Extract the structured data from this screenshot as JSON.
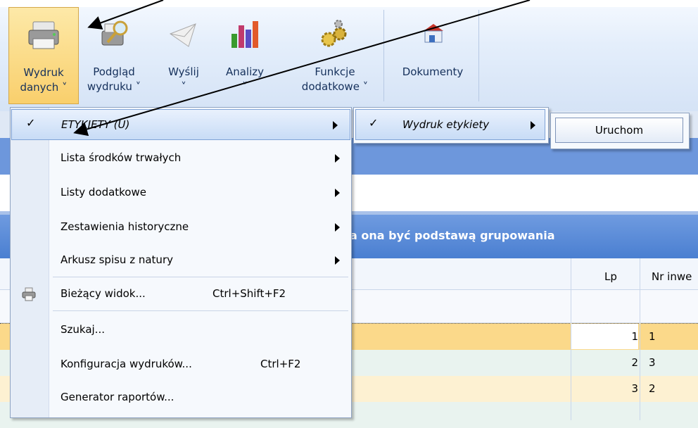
{
  "ribbon": {
    "buttons": [
      {
        "label1": "Wydruk",
        "label2": "danych ˅",
        "icon": "printer-icon"
      },
      {
        "label1": "Podgląd",
        "label2": "wydruku ˅",
        "icon": "print-preview-icon"
      },
      {
        "label1": "Wyślij",
        "label2": "˅",
        "icon": "send-mail-icon"
      },
      {
        "label1": "Analizy",
        "label2": "˅",
        "icon": "analysis-chart-icon"
      },
      {
        "label1": "Funkcje",
        "label2": "dodatkowe ˅",
        "icon": "gears-icon"
      },
      {
        "label1": "Dokumenty",
        "label2": "",
        "icon": "documents-icon"
      }
    ]
  },
  "background": {
    "header_text": "a ona być podstawą grupowania",
    "col_lp": "Lp",
    "col_nr": "Nr inwe",
    "rows": [
      {
        "lp": "1",
        "nr": "1"
      },
      {
        "lp": "2",
        "nr": "3"
      },
      {
        "lp": "3",
        "nr": "2"
      }
    ]
  },
  "menu": {
    "items": [
      {
        "label": "ETYKIETY (U)",
        "shortcut": "",
        "submenu": true,
        "checked": true
      },
      {
        "label": "Lista środków trwałych",
        "shortcut": "",
        "submenu": true
      },
      {
        "label": "Listy dodatkowe",
        "shortcut": "",
        "submenu": true
      },
      {
        "label": "Zestawienia historyczne",
        "shortcut": "",
        "submenu": true
      },
      {
        "label": "Arkusz spisu z natury",
        "shortcut": "",
        "submenu": true
      },
      {
        "label": "Bieżący widok...",
        "shortcut": "Ctrl+Shift+F2",
        "submenu": false
      },
      {
        "label": "Szukaj...",
        "shortcut": "",
        "submenu": false
      },
      {
        "label": "Konfiguracja wydruków...",
        "shortcut": "Ctrl+F2",
        "submenu": false
      },
      {
        "label": "Generator raportów...",
        "shortcut": "",
        "submenu": false
      }
    ],
    "check_glyph": "✓"
  },
  "submenu": {
    "item": "Wydruk etykiety"
  },
  "submenu2": {
    "button": "Uruchom"
  },
  "colors": {
    "ribbon_active": "#f9cf6c",
    "header_blue": "#4a7fd1",
    "row_selected": "#fbd98a",
    "row_alt1": "#e9f3ef",
    "row_alt2": "#fdf1d2"
  }
}
